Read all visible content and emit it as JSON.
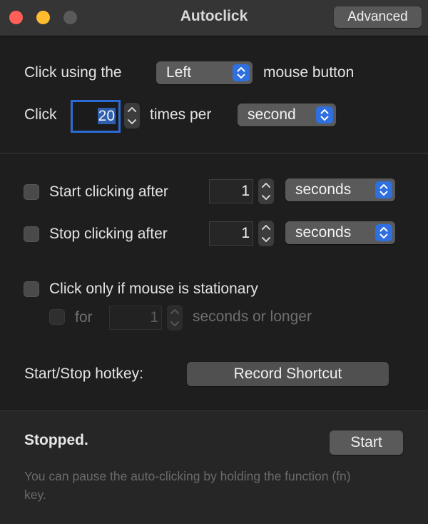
{
  "window": {
    "title": "Autoclick",
    "advanced_label": "Advanced"
  },
  "click_settings": {
    "prefix": "Click using the",
    "button_selected": "Left",
    "suffix": "mouse button",
    "click_label": "Click",
    "times_value": "20",
    "times_per_label": "times per",
    "unit_selected": "second"
  },
  "start_after": {
    "label": "Start clicking after",
    "checked": false,
    "value": "1",
    "unit": "seconds"
  },
  "stop_after": {
    "label": "Stop clicking after",
    "checked": false,
    "value": "1",
    "unit": "seconds"
  },
  "stationary": {
    "label": "Click only if mouse is stationary",
    "checked": false,
    "for_label": "for",
    "value": "1",
    "suffix": "seconds or longer"
  },
  "hotkey": {
    "label": "Start/Stop hotkey:",
    "button": "Record Shortcut"
  },
  "footer": {
    "status": "Stopped.",
    "start_button": "Start",
    "hint": "You can pause the auto-clicking by holding the function (fn) key."
  },
  "colors": {
    "close": "#ff5f57",
    "minimize": "#febc2e",
    "zoom_inactive": "#5a5a5a",
    "accent": "#2f6fe0",
    "focus_ring": "#2d6bd4"
  }
}
